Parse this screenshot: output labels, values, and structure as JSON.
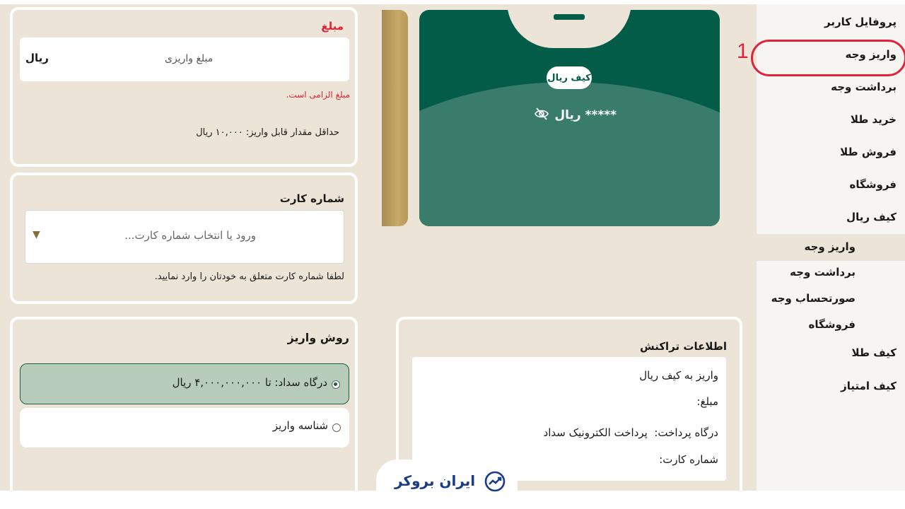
{
  "sidebar": {
    "items": [
      {
        "label": "پروفایل کاربر"
      },
      {
        "label": "واریز وجه"
      },
      {
        "label": "برداشت وجه"
      },
      {
        "label": "خرید طلا"
      },
      {
        "label": "فروش طلا"
      },
      {
        "label": "فروشگاه"
      },
      {
        "label": "کیف ریال"
      }
    ],
    "sub_items": [
      {
        "label": "واریز وجه"
      },
      {
        "label": "برداشت وجه"
      },
      {
        "label": "صورتحساب وجه"
      },
      {
        "label": "فروشگاه"
      },
      {
        "label": "کیف طلا"
      },
      {
        "label": "کیف امتیاز"
      }
    ]
  },
  "annotation": {
    "number": "1"
  },
  "wallet_card": {
    "title": "کیف ریال",
    "balance": "***** ریال"
  },
  "amount": {
    "title": "مبلغ",
    "placeholder": "مبلغ واریزی",
    "unit": "ریال",
    "error": "مبلغ الزامی است.",
    "min_note": "حداقل مقدار قابل واریز: ۱۰,۰۰۰ ریال"
  },
  "card_number": {
    "title": "شماره کارت",
    "placeholder": "ورود یا انتخاب شماره کارت...",
    "hint": "لطفا شماره کارت متعلق به خودتان را وارد نمایید."
  },
  "deposit_method": {
    "title": "روش واریز",
    "options": [
      {
        "label": "درگاه سداد: تا ۴,۰۰۰,۰۰۰,۰۰۰ ریال",
        "selected": true
      },
      {
        "label": "شناسه واریز",
        "selected": false
      }
    ]
  },
  "transaction": {
    "title": "اطلاعات تراکنش",
    "rows": [
      {
        "text": "واریز به کیف ریال"
      },
      {
        "text": "مبلغ:"
      },
      {
        "text": "درگاه پرداخت:  پرداخت الکترونیک سداد"
      },
      {
        "text": "شماره کارت:"
      }
    ]
  },
  "brand": {
    "logo_text": "ایران بروکر"
  },
  "colors": {
    "accent_green": "#035c48",
    "error_red": "#e0223a",
    "gold": "#c7a969"
  }
}
